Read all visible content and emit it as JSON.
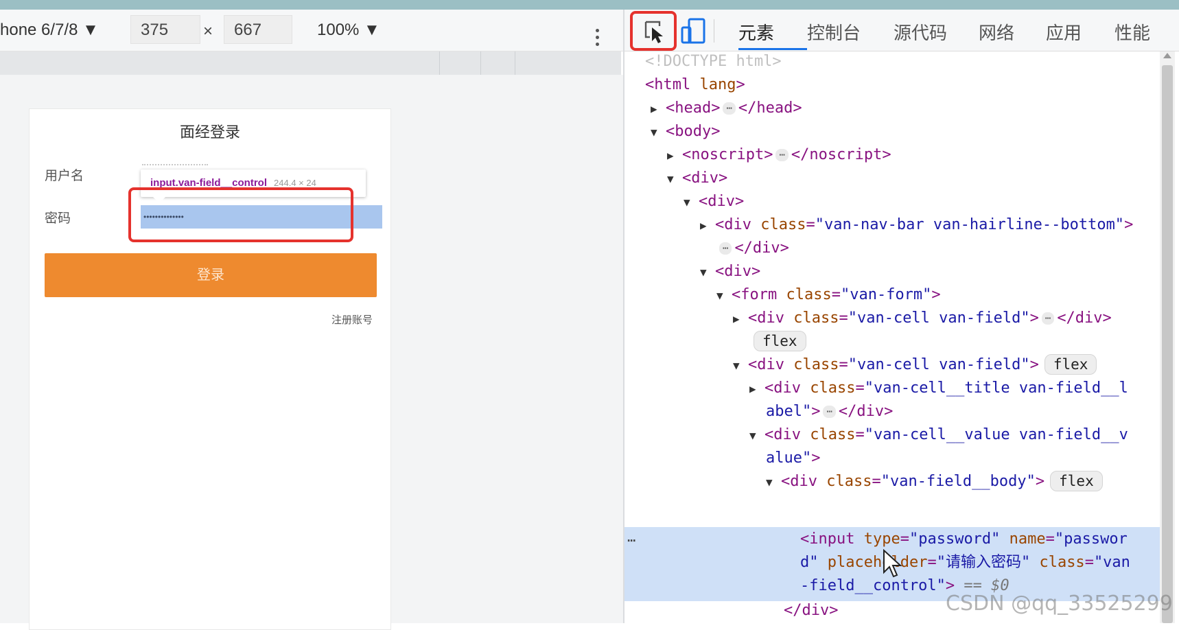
{
  "device_toolbar": {
    "device_name": "hone 6/7/8 ▼",
    "width": "375",
    "times": "×",
    "height": "667",
    "zoom": "100% ▼"
  },
  "phone": {
    "title": "面经登录",
    "username_label": "用户名",
    "password_label": "密码",
    "password_value": "••••••••••••••",
    "tooltip_name": "input.van-field__control",
    "tooltip_size": "244.4 × 24",
    "login_button": "登录",
    "register_link": "注册账号"
  },
  "devtools": {
    "tabs": [
      "元素",
      "控制台",
      "源代码",
      "网络",
      "应用",
      "性能"
    ],
    "active_tab": "元素",
    "selected_eq": "== $0"
  },
  "watermark": "CSDN @qq_33525299",
  "colors": {
    "accent_red": "#e5322d",
    "login_orange": "#ee8a2f",
    "selection_blue": "#cfe0f7",
    "tag_purple": "#881280"
  }
}
